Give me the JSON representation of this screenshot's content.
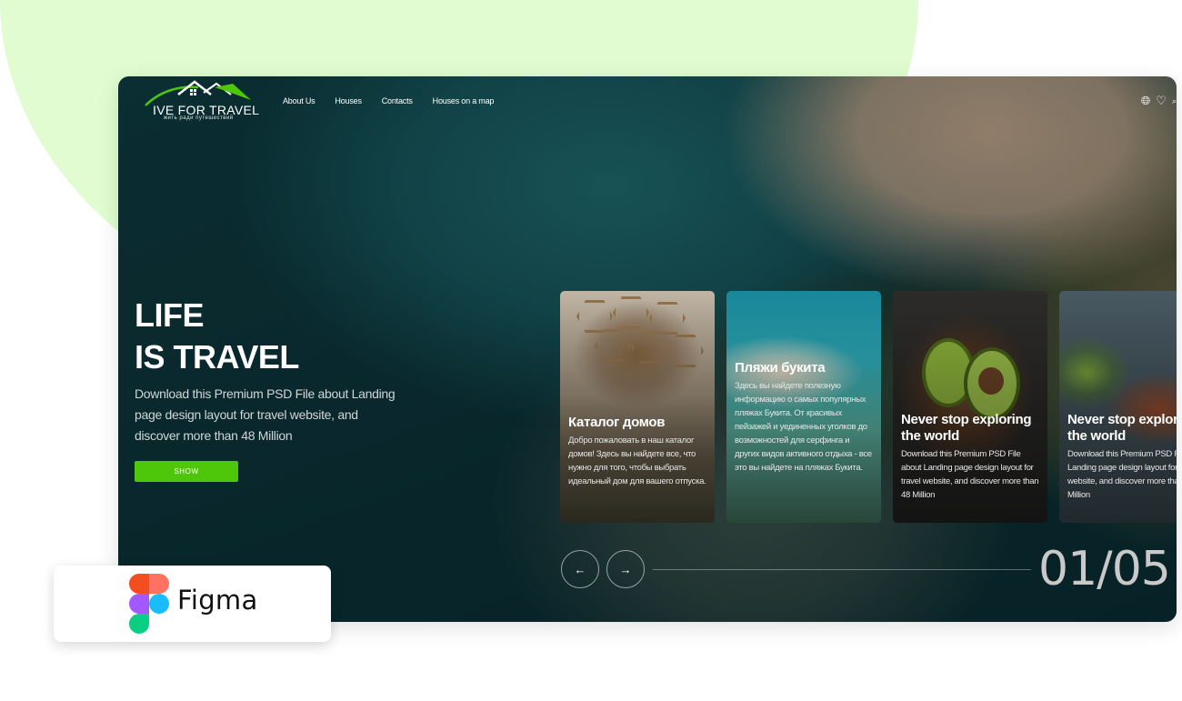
{
  "brand": {
    "name": "IVE FOR TRAVEL",
    "tagline": "жить ради путешествий"
  },
  "nav": {
    "items": [
      "About Us",
      "Houses",
      "Contacts",
      "Houses on a map"
    ]
  },
  "header_icons": [
    "globe-icon",
    "heart-icon"
  ],
  "hero": {
    "title_line1": "LIFE",
    "title_line2": "IS TRAVEL",
    "description": "Download this Premium PSD File about Landing page design layout for travel website, and discover more than 48 Million",
    "button_label": "SHOW"
  },
  "cards": [
    {
      "title": "Каталог домов",
      "text": "Добро пожаловать в наш каталог домов! Здесь вы найдете все, что нужно для того, чтобы выбрать идеальный дом для вашего отпуска."
    },
    {
      "title": "Пляжи букита",
      "text": "Здесь вы найдете полезную информацию о самых популярных пляжах Букита. От красивых пейзажей и уединенных уголков до возможностей для серфинга и других видов активного отдыха - все это вы найдете на пляжах Букита."
    },
    {
      "title": "Never stop exploring the world",
      "text": "Download this Premium PSD File about Landing page design layout for travel website, and discover more than 48 Million"
    },
    {
      "title": "Never stop exploring the world",
      "text": "Download this Premium PSD File about Landing page design layout for travel website, and discover more than 48 Million"
    }
  ],
  "slider": {
    "prev_icon": "arrow-left-icon",
    "next_icon": "arrow-right-icon",
    "counter": "01/05"
  },
  "badge": {
    "label": "Figma"
  },
  "colors": {
    "accent_green": "#4ec609",
    "blob": "#e0fcd0",
    "figma_red": "#f24e1e",
    "figma_orange": "#ff7262",
    "figma_purple": "#a259ff",
    "figma_blue": "#1abcfe",
    "figma_green": "#0acf83"
  }
}
